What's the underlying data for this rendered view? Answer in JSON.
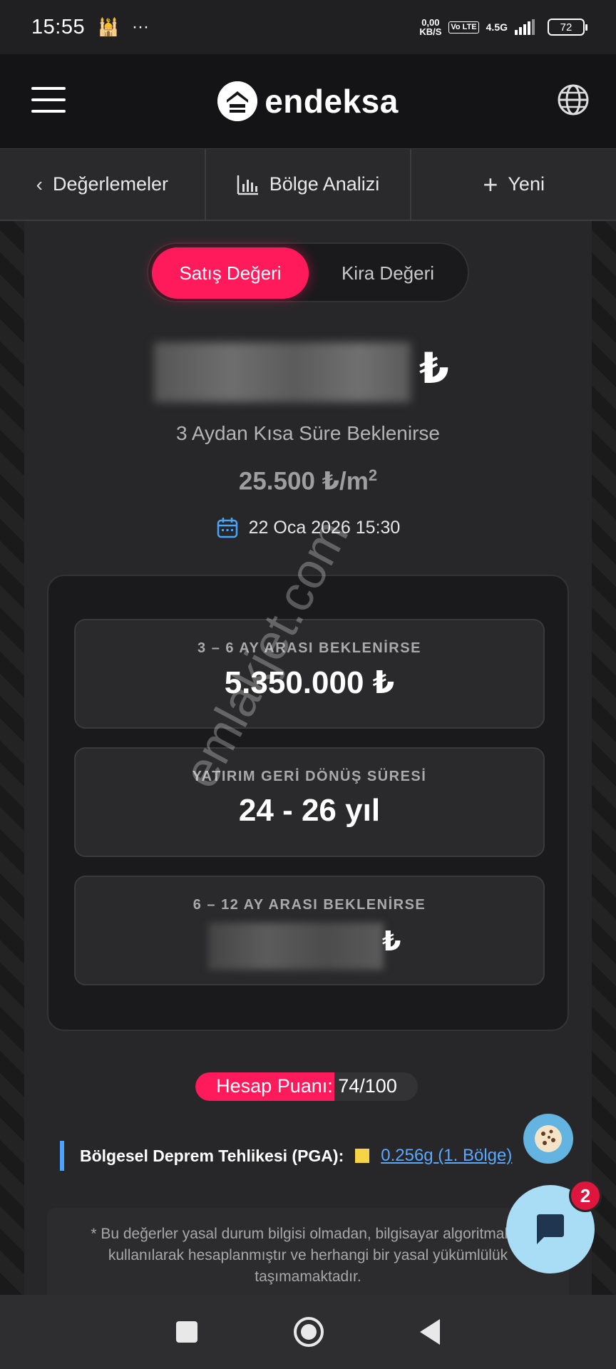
{
  "status_bar": {
    "time": "15:55",
    "speed_value": "0,00",
    "speed_unit": "KB/S",
    "volte": "Vo LTE",
    "network": "4.5G",
    "battery": "72"
  },
  "app": {
    "brand": "endeksa"
  },
  "nav": {
    "back_label": "Değerlemeler",
    "analysis_label": "Bölge Analizi",
    "new_label": "Yeni"
  },
  "toggle": {
    "active_label": "Satış Değeri",
    "inactive_label": "Kira Değeri"
  },
  "valuation": {
    "currency_symbol": "₺",
    "subtitle": "3 Aydan Kısa Süre Beklenirse",
    "per_m2": "25.500 ₺/m",
    "per_m2_sup": "2",
    "date": "22 Oca 2026 15:30"
  },
  "cards": [
    {
      "label": "3 – 6 AY ARASI BEKLENİRSE",
      "value": "5.350.000 ₺"
    },
    {
      "label": "YATIRIM GERİ DÖNÜŞ SÜRESİ",
      "value": "24 - 26 yıl"
    },
    {
      "label": "6 – 12 AY ARASI BEKLENİRSE",
      "value_currency": "₺"
    }
  ],
  "score": {
    "text": "Hesap Puanı: 74/100",
    "value": 74,
    "max": 100
  },
  "earthquake": {
    "label": "Bölgesel Deprem Tehlikesi (PGA):",
    "link": "0.256g (1. Bölge)",
    "indicator_color": "#f5d547"
  },
  "disclaimer": "* Bu değerler yasal durum bilgisi olmadan, bilgisayar algoritmaları kullanılarak hesaplanmıştır ve herhangi bir yasal yükümlülük taşımamaktadır.",
  "chat": {
    "badge": "2"
  },
  "watermark": "emlakjet.com",
  "colors": {
    "accent": "#ff1a5b",
    "link": "#5aa8ff",
    "chat_bg": "#a9dcf5"
  }
}
